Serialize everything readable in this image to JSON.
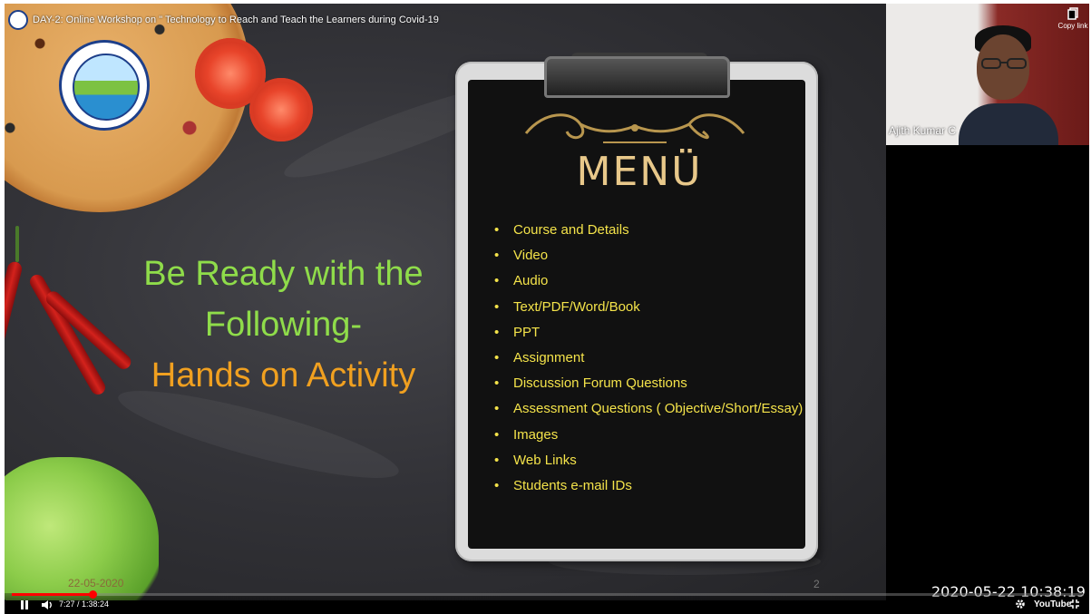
{
  "video": {
    "title": "DAY-2: Online Workshop on \" Technology to Reach and Teach the Learners during Covid-19",
    "time": "7:27 / 1:38:24",
    "progress": 0.0757,
    "platform": "YouTube"
  },
  "slide": {
    "headline_line1": "Be Ready with the",
    "headline_line2": "Following-",
    "headline_line3": "Hands on Activity",
    "menu_title": "MENÜ",
    "menu_items": [
      "Course and Details",
      "Video",
      "Audio",
      "Text/PDF/Word/Book",
      "PPT",
      "Assignment",
      "Discussion Forum Questions",
      "Assessment Questions ( Objective/Short/Essay)",
      "Images",
      "Web Links",
      "Students e-mail IDs"
    ],
    "footer_date": "22-05-2020",
    "page_number": "2"
  },
  "participant": {
    "name": "Ajith Kumar C"
  },
  "overlay": {
    "copy_link_label": "Copy link",
    "timestamp": "2020-05-22  10:38:19"
  },
  "colors": {
    "headline_green": "#8fdc4a",
    "headline_orange": "#f0a020",
    "menu_text": "#f4e34a",
    "progress": "#ff0000"
  },
  "icons": {
    "play_pause": "pause-icon",
    "volume": "volume-icon",
    "settings": "gear-icon",
    "fullscreen": "fullscreen-exit-icon",
    "copy": "copy-icon"
  }
}
